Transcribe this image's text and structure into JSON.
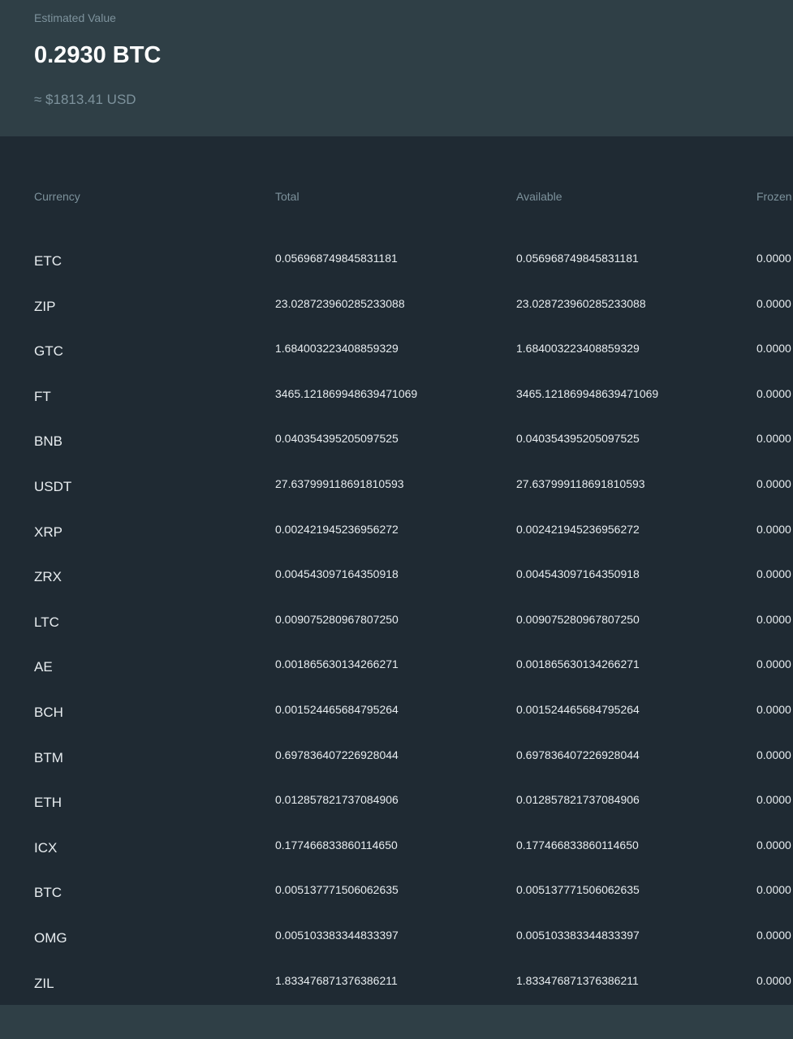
{
  "summary": {
    "label": "Estimated Value",
    "value": "0.2930 BTC",
    "usd": "≈ $1813.41 USD"
  },
  "table": {
    "headers": [
      "Currency",
      "Total",
      "Available",
      "Frozen"
    ],
    "rows": [
      {
        "currency": "ETC",
        "total": "0.056968749845831181",
        "available": "0.056968749845831181",
        "frozen": "0.0000"
      },
      {
        "currency": "ZIP",
        "total": "23.028723960285233088",
        "available": "23.028723960285233088",
        "frozen": "0.0000"
      },
      {
        "currency": "GTC",
        "total": "1.684003223408859329",
        "available": "1.684003223408859329",
        "frozen": "0.0000"
      },
      {
        "currency": "FT",
        "total": "3465.121869948639471069",
        "available": "3465.121869948639471069",
        "frozen": "0.0000"
      },
      {
        "currency": "BNB",
        "total": "0.040354395205097525",
        "available": "0.040354395205097525",
        "frozen": "0.0000"
      },
      {
        "currency": "USDT",
        "total": "27.637999118691810593",
        "available": "27.637999118691810593",
        "frozen": "0.0000"
      },
      {
        "currency": "XRP",
        "total": "0.002421945236956272",
        "available": "0.002421945236956272",
        "frozen": "0.0000"
      },
      {
        "currency": "ZRX",
        "total": "0.004543097164350918",
        "available": "0.004543097164350918",
        "frozen": "0.0000"
      },
      {
        "currency": "LTC",
        "total": "0.009075280967807250",
        "available": "0.009075280967807250",
        "frozen": "0.0000"
      },
      {
        "currency": "AE",
        "total": "0.001865630134266271",
        "available": "0.001865630134266271",
        "frozen": "0.0000"
      },
      {
        "currency": "BCH",
        "total": "0.001524465684795264",
        "available": "0.001524465684795264",
        "frozen": "0.0000"
      },
      {
        "currency": "BTM",
        "total": "0.697836407226928044",
        "available": "0.697836407226928044",
        "frozen": "0.0000"
      },
      {
        "currency": "ETH",
        "total": "0.012857821737084906",
        "available": "0.012857821737084906",
        "frozen": "0.0000"
      },
      {
        "currency": "ICX",
        "total": "0.177466833860114650",
        "available": "0.177466833860114650",
        "frozen": "0.0000"
      },
      {
        "currency": "BTC",
        "total": "0.005137771506062635",
        "available": "0.005137771506062635",
        "frozen": "0.0000"
      },
      {
        "currency": "OMG",
        "total": "0.005103383344833397",
        "available": "0.005103383344833397",
        "frozen": "0.0000"
      },
      {
        "currency": "ZIL",
        "total": "1.833476871376386211",
        "available": "1.833476871376386211",
        "frozen": "0.0000"
      }
    ]
  }
}
